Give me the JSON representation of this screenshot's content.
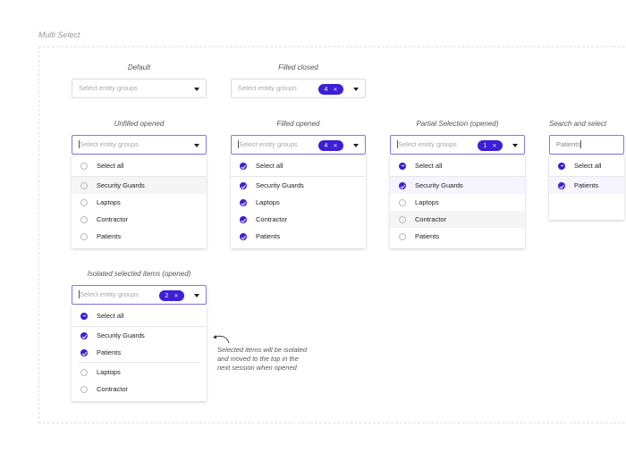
{
  "section_title": "Multi Select",
  "accent_color": "#3d1fd6",
  "placeholder": "Select entity groups",
  "note": [
    "Selected items will be isolated",
    "and moved to the top in the",
    "next session when opened"
  ],
  "components": [
    {
      "label": "Default",
      "open": false,
      "count": null,
      "input": "Select entity groups",
      "items": []
    },
    {
      "label": "Filled closed",
      "open": false,
      "count": "4",
      "input": "Select entity groups",
      "items": []
    },
    {
      "label": "Unfilled opened",
      "open": true,
      "count": null,
      "input": "Select entity groups",
      "select_all": "none",
      "items": [
        {
          "text": "Select all",
          "state": "off"
        },
        {
          "text": "Security Guards",
          "state": "off",
          "hl": "hover"
        },
        {
          "text": "Laptops",
          "state": "off"
        },
        {
          "text": "Contractor",
          "state": "off"
        },
        {
          "text": "Patients",
          "state": "off"
        }
      ]
    },
    {
      "label": "Filled opened",
      "open": true,
      "count": "4",
      "input": "Select entity groups",
      "items": [
        {
          "text": "Select all",
          "state": "on"
        },
        {
          "text": "Security Guards",
          "state": "on"
        },
        {
          "text": "Laptops",
          "state": "on"
        },
        {
          "text": "Contractor",
          "state": "on"
        },
        {
          "text": "Patients",
          "state": "on"
        }
      ]
    },
    {
      "label": "Partial Selection (opened)",
      "open": true,
      "count": "1",
      "input": "Select entity groups",
      "items": [
        {
          "text": "Select all",
          "state": "part"
        },
        {
          "text": "Security Guards",
          "state": "on",
          "hl": "selected"
        },
        {
          "text": "Laptops",
          "state": "off"
        },
        {
          "text": "Contractor",
          "state": "off",
          "hl": "hover"
        },
        {
          "text": "Patients",
          "state": "off"
        }
      ]
    },
    {
      "label": "Search and select",
      "open": true,
      "count": null,
      "input": "Patients",
      "typed": true,
      "items": [
        {
          "text": "Select all",
          "state": "part"
        },
        {
          "text": "Patients",
          "state": "on",
          "hl": "selected"
        }
      ]
    },
    {
      "label": "Isolated selected items (opened)",
      "open": true,
      "count": "2",
      "input": "Select entity groups",
      "items": [
        {
          "text": "Select all",
          "state": "part"
        },
        {
          "text": "Security Guards",
          "state": "on"
        },
        {
          "text": "Patients",
          "state": "on",
          "group_end": true
        },
        {
          "text": "Laptops",
          "state": "off"
        },
        {
          "text": "Contractor",
          "state": "off"
        }
      ]
    }
  ]
}
